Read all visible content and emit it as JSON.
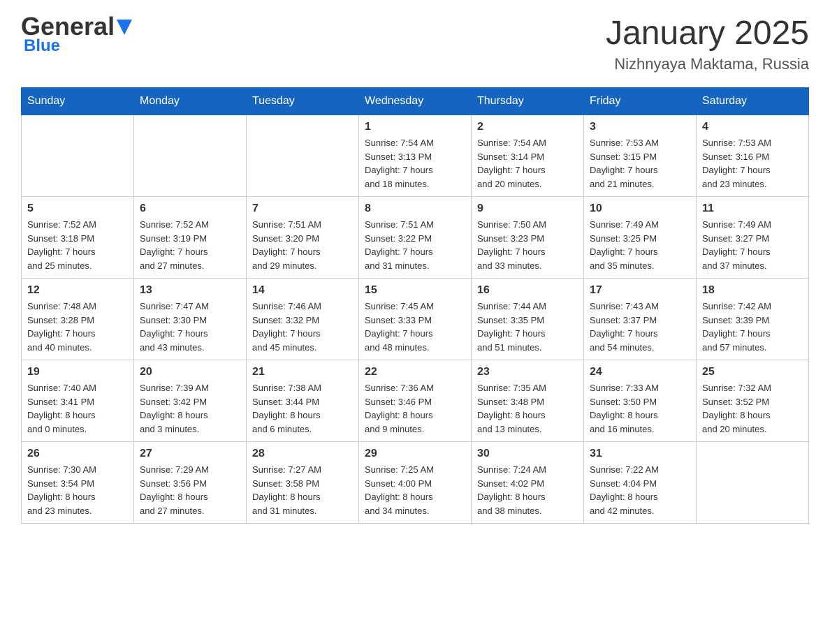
{
  "header": {
    "logo_general": "General",
    "logo_blue": "Blue",
    "title": "January 2025",
    "location": "Nizhnyaya Maktama, Russia"
  },
  "days_of_week": [
    "Sunday",
    "Monday",
    "Tuesday",
    "Wednesday",
    "Thursday",
    "Friday",
    "Saturday"
  ],
  "weeks": [
    [
      {
        "day": "",
        "info": ""
      },
      {
        "day": "",
        "info": ""
      },
      {
        "day": "",
        "info": ""
      },
      {
        "day": "1",
        "info": "Sunrise: 7:54 AM\nSunset: 3:13 PM\nDaylight: 7 hours\nand 18 minutes."
      },
      {
        "day": "2",
        "info": "Sunrise: 7:54 AM\nSunset: 3:14 PM\nDaylight: 7 hours\nand 20 minutes."
      },
      {
        "day": "3",
        "info": "Sunrise: 7:53 AM\nSunset: 3:15 PM\nDaylight: 7 hours\nand 21 minutes."
      },
      {
        "day": "4",
        "info": "Sunrise: 7:53 AM\nSunset: 3:16 PM\nDaylight: 7 hours\nand 23 minutes."
      }
    ],
    [
      {
        "day": "5",
        "info": "Sunrise: 7:52 AM\nSunset: 3:18 PM\nDaylight: 7 hours\nand 25 minutes."
      },
      {
        "day": "6",
        "info": "Sunrise: 7:52 AM\nSunset: 3:19 PM\nDaylight: 7 hours\nand 27 minutes."
      },
      {
        "day": "7",
        "info": "Sunrise: 7:51 AM\nSunset: 3:20 PM\nDaylight: 7 hours\nand 29 minutes."
      },
      {
        "day": "8",
        "info": "Sunrise: 7:51 AM\nSunset: 3:22 PM\nDaylight: 7 hours\nand 31 minutes."
      },
      {
        "day": "9",
        "info": "Sunrise: 7:50 AM\nSunset: 3:23 PM\nDaylight: 7 hours\nand 33 minutes."
      },
      {
        "day": "10",
        "info": "Sunrise: 7:49 AM\nSunset: 3:25 PM\nDaylight: 7 hours\nand 35 minutes."
      },
      {
        "day": "11",
        "info": "Sunrise: 7:49 AM\nSunset: 3:27 PM\nDaylight: 7 hours\nand 37 minutes."
      }
    ],
    [
      {
        "day": "12",
        "info": "Sunrise: 7:48 AM\nSunset: 3:28 PM\nDaylight: 7 hours\nand 40 minutes."
      },
      {
        "day": "13",
        "info": "Sunrise: 7:47 AM\nSunset: 3:30 PM\nDaylight: 7 hours\nand 43 minutes."
      },
      {
        "day": "14",
        "info": "Sunrise: 7:46 AM\nSunset: 3:32 PM\nDaylight: 7 hours\nand 45 minutes."
      },
      {
        "day": "15",
        "info": "Sunrise: 7:45 AM\nSunset: 3:33 PM\nDaylight: 7 hours\nand 48 minutes."
      },
      {
        "day": "16",
        "info": "Sunrise: 7:44 AM\nSunset: 3:35 PM\nDaylight: 7 hours\nand 51 minutes."
      },
      {
        "day": "17",
        "info": "Sunrise: 7:43 AM\nSunset: 3:37 PM\nDaylight: 7 hours\nand 54 minutes."
      },
      {
        "day": "18",
        "info": "Sunrise: 7:42 AM\nSunset: 3:39 PM\nDaylight: 7 hours\nand 57 minutes."
      }
    ],
    [
      {
        "day": "19",
        "info": "Sunrise: 7:40 AM\nSunset: 3:41 PM\nDaylight: 8 hours\nand 0 minutes."
      },
      {
        "day": "20",
        "info": "Sunrise: 7:39 AM\nSunset: 3:42 PM\nDaylight: 8 hours\nand 3 minutes."
      },
      {
        "day": "21",
        "info": "Sunrise: 7:38 AM\nSunset: 3:44 PM\nDaylight: 8 hours\nand 6 minutes."
      },
      {
        "day": "22",
        "info": "Sunrise: 7:36 AM\nSunset: 3:46 PM\nDaylight: 8 hours\nand 9 minutes."
      },
      {
        "day": "23",
        "info": "Sunrise: 7:35 AM\nSunset: 3:48 PM\nDaylight: 8 hours\nand 13 minutes."
      },
      {
        "day": "24",
        "info": "Sunrise: 7:33 AM\nSunset: 3:50 PM\nDaylight: 8 hours\nand 16 minutes."
      },
      {
        "day": "25",
        "info": "Sunrise: 7:32 AM\nSunset: 3:52 PM\nDaylight: 8 hours\nand 20 minutes."
      }
    ],
    [
      {
        "day": "26",
        "info": "Sunrise: 7:30 AM\nSunset: 3:54 PM\nDaylight: 8 hours\nand 23 minutes."
      },
      {
        "day": "27",
        "info": "Sunrise: 7:29 AM\nSunset: 3:56 PM\nDaylight: 8 hours\nand 27 minutes."
      },
      {
        "day": "28",
        "info": "Sunrise: 7:27 AM\nSunset: 3:58 PM\nDaylight: 8 hours\nand 31 minutes."
      },
      {
        "day": "29",
        "info": "Sunrise: 7:25 AM\nSunset: 4:00 PM\nDaylight: 8 hours\nand 34 minutes."
      },
      {
        "day": "30",
        "info": "Sunrise: 7:24 AM\nSunset: 4:02 PM\nDaylight: 8 hours\nand 38 minutes."
      },
      {
        "day": "31",
        "info": "Sunrise: 7:22 AM\nSunset: 4:04 PM\nDaylight: 8 hours\nand 42 minutes."
      },
      {
        "day": "",
        "info": ""
      }
    ]
  ]
}
